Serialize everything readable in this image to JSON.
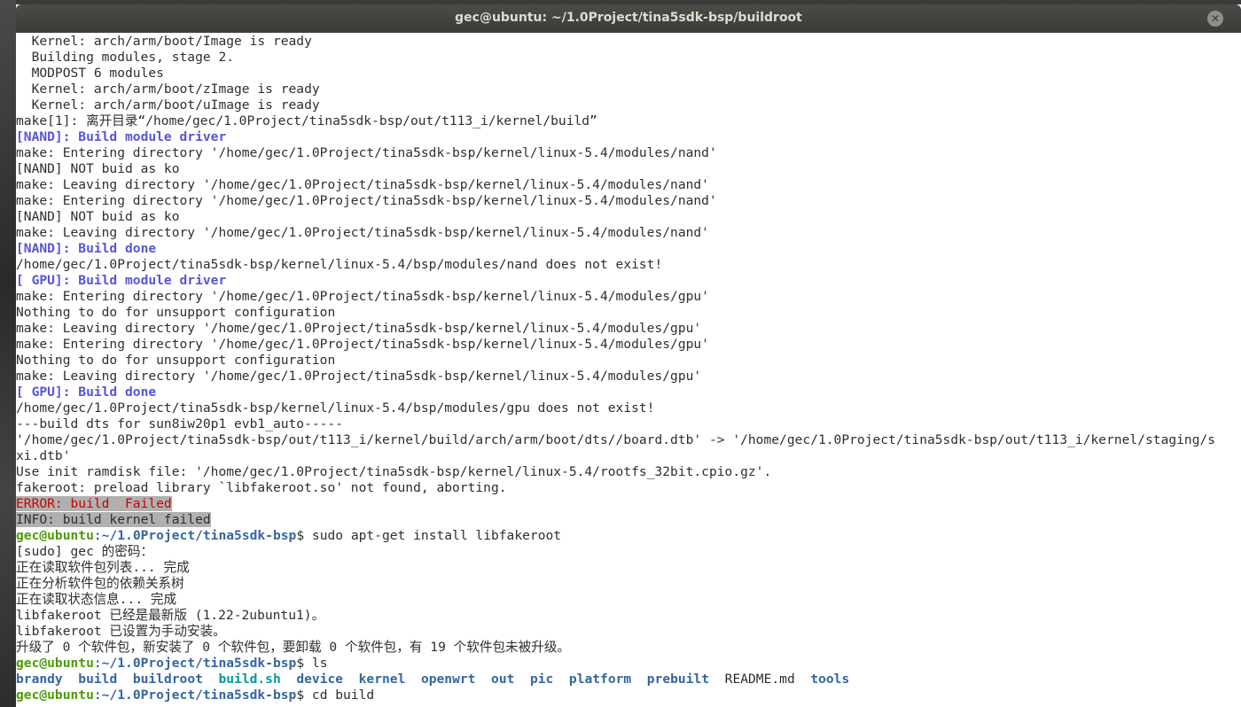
{
  "window": {
    "title": "gec@ubuntu: ~/1.0Project/tina5sdk-bsp/buildroot"
  },
  "log": [
    {
      "t": "plain",
      "text": "  Kernel: arch/arm/boot/Image is ready"
    },
    {
      "t": "plain",
      "text": "  Building modules, stage 2."
    },
    {
      "t": "plain",
      "text": "  MODPOST 6 modules"
    },
    {
      "t": "plain",
      "text": "  Kernel: arch/arm/boot/zImage is ready"
    },
    {
      "t": "plain",
      "text": "  Kernel: arch/arm/boot/uImage is ready"
    },
    {
      "t": "plain",
      "text": "make[1]: 离开目录“/home/gec/1.0Project/tina5sdk-bsp/out/t113_i/kernel/build”"
    },
    {
      "t": "blue",
      "text": "[NAND]: Build module driver"
    },
    {
      "t": "plain",
      "text": "make: Entering directory '/home/gec/1.0Project/tina5sdk-bsp/kernel/linux-5.4/modules/nand'"
    },
    {
      "t": "plain",
      "text": "[NAND] NOT buid as ko"
    },
    {
      "t": "plain",
      "text": "make: Leaving directory '/home/gec/1.0Project/tina5sdk-bsp/kernel/linux-5.4/modules/nand'"
    },
    {
      "t": "plain",
      "text": "make: Entering directory '/home/gec/1.0Project/tina5sdk-bsp/kernel/linux-5.4/modules/nand'"
    },
    {
      "t": "plain",
      "text": "[NAND] NOT buid as ko"
    },
    {
      "t": "plain",
      "text": "make: Leaving directory '/home/gec/1.0Project/tina5sdk-bsp/kernel/linux-5.4/modules/nand'"
    },
    {
      "t": "blue",
      "text": "[NAND]: Build done"
    },
    {
      "t": "plain",
      "text": "/home/gec/1.0Project/tina5sdk-bsp/kernel/linux-5.4/bsp/modules/nand does not exist!"
    },
    {
      "t": "blue",
      "text": "[ GPU]: Build module driver"
    },
    {
      "t": "plain",
      "text": "make: Entering directory '/home/gec/1.0Project/tina5sdk-bsp/kernel/linux-5.4/modules/gpu'"
    },
    {
      "t": "plain",
      "text": "Nothing to do for unsupport configuration"
    },
    {
      "t": "plain",
      "text": "make: Leaving directory '/home/gec/1.0Project/tina5sdk-bsp/kernel/linux-5.4/modules/gpu'"
    },
    {
      "t": "plain",
      "text": "make: Entering directory '/home/gec/1.0Project/tina5sdk-bsp/kernel/linux-5.4/modules/gpu'"
    },
    {
      "t": "plain",
      "text": "Nothing to do for unsupport configuration"
    },
    {
      "t": "plain",
      "text": "make: Leaving directory '/home/gec/1.0Project/tina5sdk-bsp/kernel/linux-5.4/modules/gpu'"
    },
    {
      "t": "blue",
      "text": "[ GPU]: Build done"
    },
    {
      "t": "plain",
      "text": "/home/gec/1.0Project/tina5sdk-bsp/kernel/linux-5.4/bsp/modules/gpu does not exist!"
    },
    {
      "t": "plain",
      "text": "---build dts for sun8iw20p1 evb1_auto-----"
    },
    {
      "t": "plain",
      "text": "'/home/gec/1.0Project/tina5sdk-bsp/out/t113_i/kernel/build/arch/arm/boot/dts//board.dtb' -> '/home/gec/1.0Project/tina5sdk-bsp/out/t113_i/kernel/staging/s"
    },
    {
      "t": "plain",
      "text": "xi.dtb'"
    },
    {
      "t": "plain",
      "text": "Use init ramdisk file: '/home/gec/1.0Project/tina5sdk-bsp/kernel/linux-5.4/rootfs_32bit.cpio.gz'."
    },
    {
      "t": "plain",
      "text": "fakeroot: preload library `libfakeroot.so' not found, aborting."
    },
    {
      "t": "error",
      "text": "ERROR: build  Failed"
    },
    {
      "t": "info",
      "text": "INFO: build kernel failed"
    },
    {
      "t": "prompt",
      "user": "gec@ubuntu",
      "sep": ":",
      "path": "~/1.0Project/tina5sdk-bsp",
      "dollar": "$ ",
      "cmd": "sudo apt-get install libfakeroot"
    },
    {
      "t": "plain",
      "text": "[sudo] gec 的密码："
    },
    {
      "t": "plain",
      "text": "正在读取软件包列表... 完成"
    },
    {
      "t": "plain",
      "text": "正在分析软件包的依赖关系树"
    },
    {
      "t": "plain",
      "text": "正在读取状态信息... 完成"
    },
    {
      "t": "plain",
      "text": "libfakeroot 已经是最新版 (1.22-2ubuntu1)。"
    },
    {
      "t": "plain",
      "text": "libfakeroot 已设置为手动安装。"
    },
    {
      "t": "plain",
      "text": "升级了 0 个软件包，新安装了 0 个软件包，要卸载 0 个软件包，有 19 个软件包未被升级。"
    },
    {
      "t": "prompt",
      "user": "gec@ubuntu",
      "sep": ":",
      "path": "~/1.0Project/tina5sdk-bsp",
      "dollar": "$ ",
      "cmd": "ls"
    },
    {
      "t": "ls",
      "items": [
        {
          "name": "brandy",
          "kind": "dir"
        },
        {
          "name": "build",
          "kind": "dir"
        },
        {
          "name": "buildroot",
          "kind": "dir"
        },
        {
          "name": "build.sh",
          "kind": "exec"
        },
        {
          "name": "device",
          "kind": "dir"
        },
        {
          "name": "kernel",
          "kind": "dir"
        },
        {
          "name": "openwrt",
          "kind": "dir"
        },
        {
          "name": "out",
          "kind": "dir"
        },
        {
          "name": "pic",
          "kind": "dir"
        },
        {
          "name": "platform",
          "kind": "dir"
        },
        {
          "name": "prebuilt",
          "kind": "dir"
        },
        {
          "name": "README.md",
          "kind": "file"
        },
        {
          "name": "tools",
          "kind": "dir"
        }
      ]
    },
    {
      "t": "prompt",
      "user": "gec@ubuntu",
      "sep": ":",
      "path": "~/1.0Project/tina5sdk-bsp",
      "dollar": "$ ",
      "cmd": "cd build"
    }
  ],
  "colors": {
    "blue_status": "#5654d8",
    "prompt_user": "#4e9a06",
    "prompt_path": "#3465a4",
    "error": "#cc0000",
    "exec": "#06989a",
    "selection": "#b0b0b0"
  },
  "icons": {
    "close": "close-icon"
  }
}
